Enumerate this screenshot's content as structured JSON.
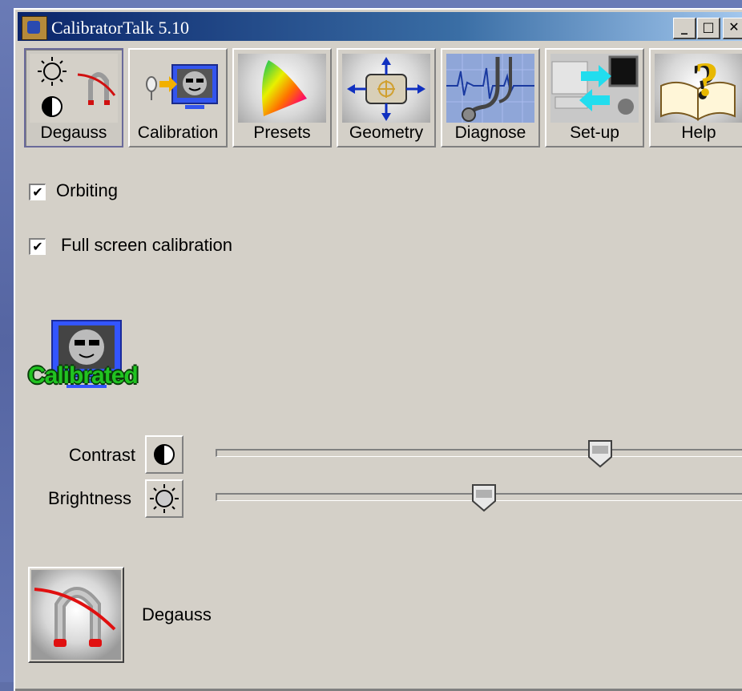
{
  "window": {
    "title": "CalibratorTalk 5.10",
    "controls": {
      "minimize": "_",
      "maximize": "□",
      "close": "✕"
    }
  },
  "toolbar": {
    "items": [
      {
        "label": "Degauss",
        "icon": "degauss-icon",
        "active": true
      },
      {
        "label": "Calibration",
        "icon": "calibration-monitor-icon",
        "active": false
      },
      {
        "label": "Presets",
        "icon": "color-gamut-icon",
        "active": false
      },
      {
        "label": "Geometry",
        "icon": "geometry-arrows-icon",
        "active": false
      },
      {
        "label": "Diagnose",
        "icon": "stethoscope-icon",
        "active": false
      },
      {
        "label": "Set-up",
        "icon": "setup-arrows-icon",
        "active": false
      },
      {
        "label": "Help",
        "icon": "help-book-icon",
        "active": false
      }
    ]
  },
  "options": {
    "orbiting": {
      "label": "Orbiting",
      "checked": true
    },
    "full_screen": {
      "label": "Full screen calibration",
      "checked": true
    },
    "check_glyph": "✔"
  },
  "status": {
    "text": "Calibrated",
    "color": "#21c321"
  },
  "sliders": {
    "contrast": {
      "label": "Contrast",
      "value": 0.7
    },
    "brightness": {
      "label": "Brightness",
      "value": 0.48
    }
  },
  "degauss_action": {
    "label": "Degauss"
  }
}
